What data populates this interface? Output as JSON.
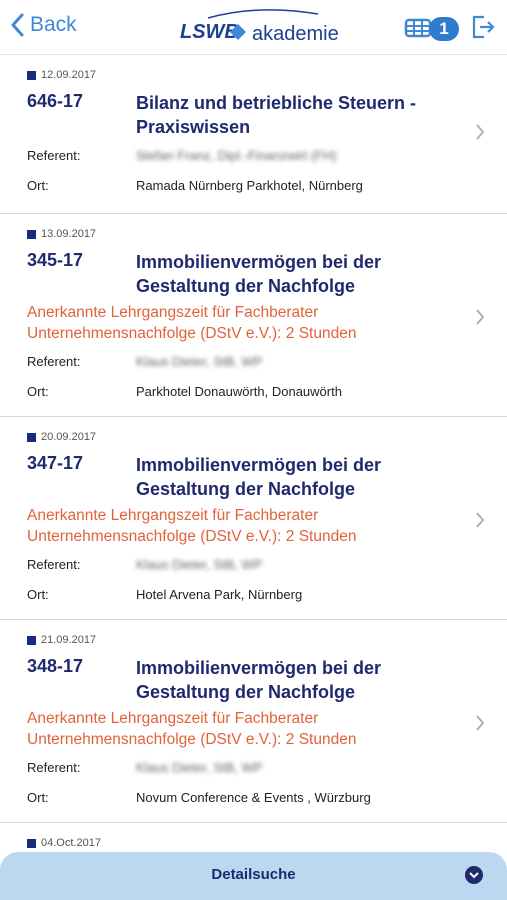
{
  "header": {
    "back_label": "Back",
    "logo_text_left": "LSWB",
    "logo_text_right": "akademie",
    "cart_count": "1"
  },
  "items": [
    {
      "date": "12.09.2017",
      "code": "646-17",
      "title": "Bilanz und betriebliche Steuern - Praxiswissen",
      "note": "",
      "referent_label": "Referent:",
      "referent_value": "Stefan Franz, Dipl.-Finanzwirt (FH)",
      "ort_label": "Ort:",
      "ort_value": "Ramada Nürnberg Parkhotel, Nürnberg"
    },
    {
      "date": "13.09.2017",
      "code": "345-17",
      "title": "Immobilienvermögen bei der Gestaltung der Nachfolge",
      "note": "Anerkannte Lehrgangszeit für Fachberater Unternehmensnachfolge (DStV e.V.): 2 Stunden",
      "referent_label": "Referent:",
      "referent_value": "Klaus Dieter, StB, WP",
      "ort_label": "Ort:",
      "ort_value": "Parkhotel Donauwörth, Donauwörth"
    },
    {
      "date": "20.09.2017",
      "code": "347-17",
      "title": "Immobilienvermögen bei der Gestaltung der Nachfolge",
      "note": "Anerkannte Lehrgangszeit für Fachberater Unternehmensnachfolge (DStV e.V.): 2 Stunden",
      "referent_label": "Referent:",
      "referent_value": "Klaus Dieter, StB, WP",
      "ort_label": "Ort:",
      "ort_value": "Hotel Arvena Park, Nürnberg"
    },
    {
      "date": "21.09.2017",
      "code": "348-17",
      "title": "Immobilienvermögen bei der Gestaltung der Nachfolge",
      "note": "Anerkannte Lehrgangszeit für Fachberater Unternehmensnachfolge (DStV e.V.): 2 Stunden",
      "referent_label": "Referent:",
      "referent_value": "Klaus Dieter, StB, WP",
      "ort_label": "Ort:",
      "ort_value": "Novum Conference & Events , Würzburg"
    },
    {
      "date": "04.Oct.2017"
    }
  ],
  "footer": {
    "detailsuche_label": "Detailsuche"
  }
}
